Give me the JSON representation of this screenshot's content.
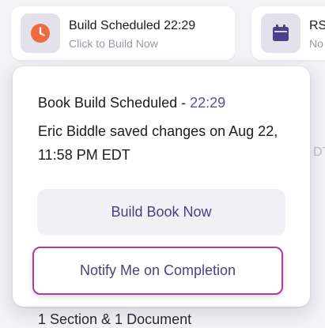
{
  "build_card": {
    "title": "Build Scheduled 22:29",
    "subtitle": "Click to Build Now",
    "icon": "clock-icon"
  },
  "rsvp_card": {
    "title": "RSV",
    "subtitle": "No",
    "icon": "calendar-icon"
  },
  "background": {
    "right_fragment": "DT",
    "bottom_text": "1 Section & 1 Document"
  },
  "popover": {
    "title_prefix": "Book Build Scheduled - ",
    "title_time": "22:29",
    "message": "Eric Biddle saved changes on Aug 22, 11:58 PM EDT",
    "build_now_label": "Build Book Now",
    "notify_label": "Notify Me on Completion"
  },
  "colors": {
    "accent": "#5a4ea0",
    "clock": "#f06a3f",
    "calendar": "#4e3f8a",
    "focus_ring": "#b03a9e"
  }
}
